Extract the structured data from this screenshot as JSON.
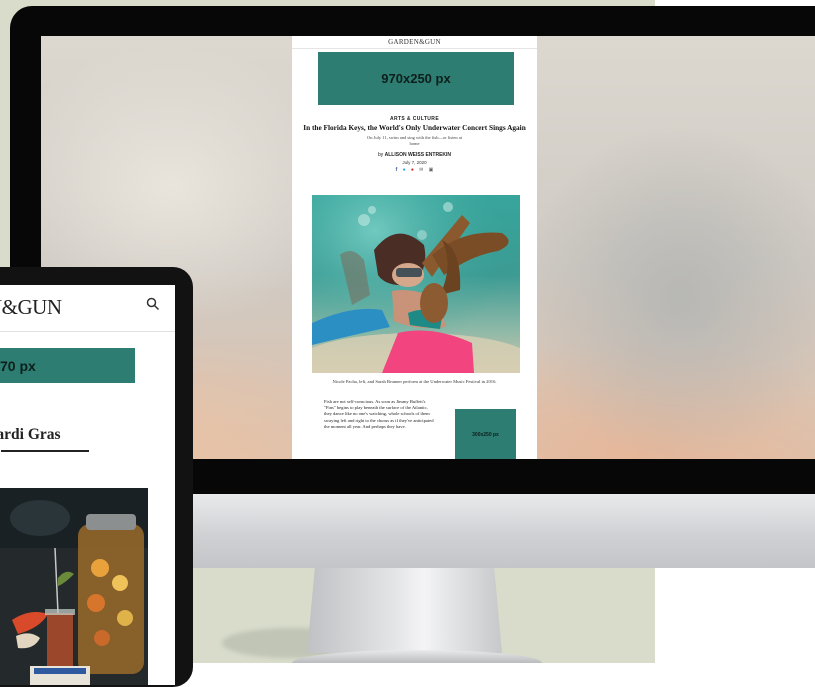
{
  "monitor_page": {
    "site_logo": "GARDEN&GUN",
    "leaderboard_ad": "970x250 px",
    "kicker": "ARTS & CULTURE",
    "headline": "In the Florida Keys, the World's Only Underwater Concert Sings Again",
    "dek": "On July 11, swim and sing with the fish—or listen at home",
    "byline_prefix": "by",
    "author": "ALLISON WEISS ENTREKIN",
    "date": "July 7, 2020",
    "share_icons": [
      "facebook-icon",
      "twitter-icon",
      "pinterest-icon",
      "email-icon",
      "print-icon"
    ],
    "caption": "Nicole Pacha, left, and Sarah Brunner perform at the Underwater Music Festival in 2016.",
    "body_text": "Fish are not self-conscious. As soon as Jimmy Buffett's \"Fins\" begins to play beneath the surface of the Atlantic, they dance like no one's watching, whole schools of them swaying left and right to the chorus as if they've anticipated the moment all year. And perhaps they have.",
    "rectangle_ad": "300x250 px"
  },
  "tablet_page": {
    "site_logo": "N&GUN",
    "leaderboard_ad": "70 px",
    "headline": "to Mardi Gras",
    "search_icon": "search-icon"
  },
  "colors": {
    "ad_teal": "#2e7d72",
    "background_panel": "#d9dccb",
    "monitor_bezel": "#070707"
  }
}
